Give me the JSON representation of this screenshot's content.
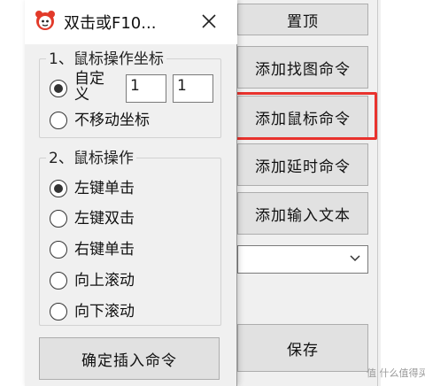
{
  "main_window": {
    "buttons": {
      "top": "置顶",
      "add_find_image": "添加找图命令",
      "add_mouse": "添加鼠标命令",
      "add_delay": "添加延时命令",
      "add_input_text": "添加输入文本",
      "save": "保存"
    },
    "combo": {
      "value": ""
    }
  },
  "dialog": {
    "title": "双击或F10...",
    "close_symbol": "✕",
    "group1": {
      "title": "1、鼠标操作坐标",
      "custom_label_line1": "自定",
      "custom_label_line2": "义",
      "x_value": "1",
      "y_value": "1",
      "no_move_label": "不移动坐标",
      "selected": "custom"
    },
    "group2": {
      "title": "2、鼠标操作",
      "options": [
        "左键单击",
        "左键双击",
        "右键单击",
        "向上滚动",
        "向下滚动"
      ],
      "selected_index": 0
    },
    "confirm_button": "确定插入命令"
  },
  "colors": {
    "highlight": "#e8322d",
    "window_bg": "#f0f0f0",
    "button_bg": "#e1e1e1"
  },
  "watermark": "值 什么值得买"
}
